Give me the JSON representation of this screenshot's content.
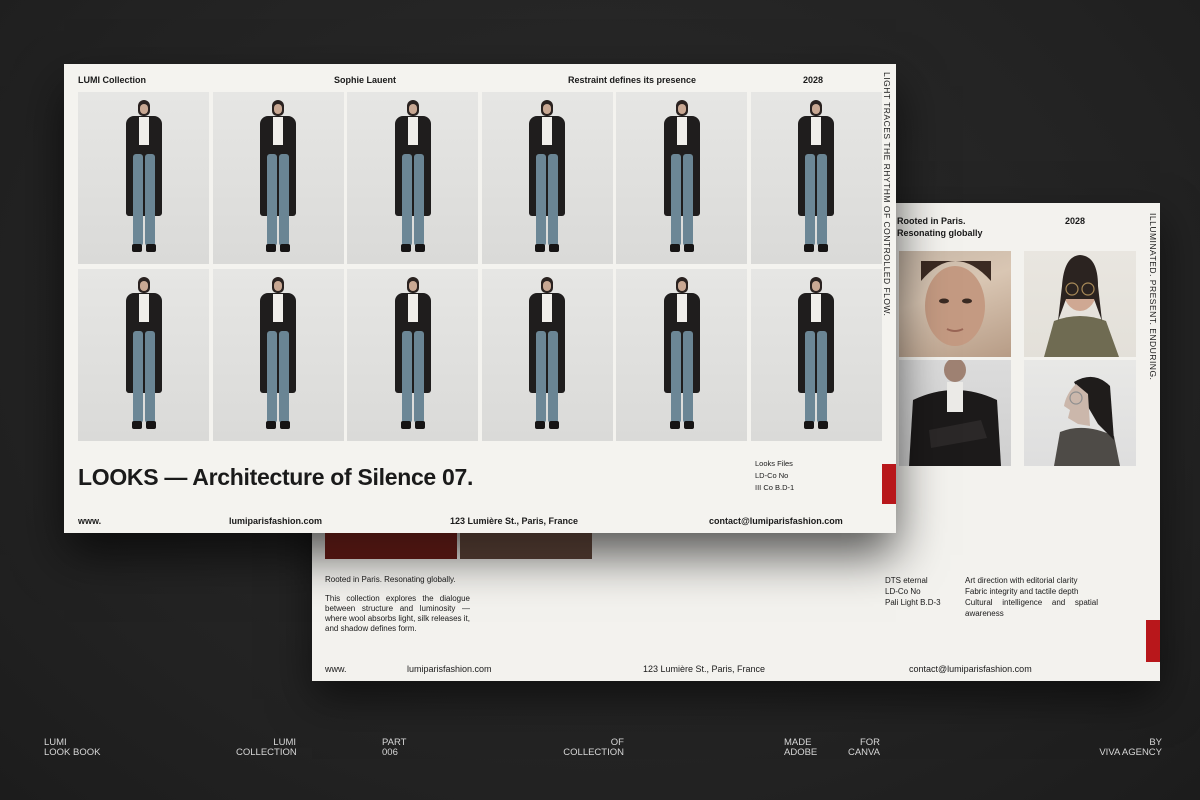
{
  "front": {
    "header": {
      "collection": "LUMI Collection",
      "designer": "Sophie Lauent",
      "tagline": "Restraint defines its presence",
      "year": "2028"
    },
    "side_text": "LIGHT TRACES THE RHYTHM OF CONTROLLED FLOW.",
    "title": "LOOKS — Architecture of Silence 07.",
    "files": [
      "Looks Files",
      "LD-Co No",
      "III Co B.D-1"
    ],
    "footer": {
      "www": "www.",
      "site": "lumiparisfashion.com",
      "address": "123 Lumière St., Paris, France",
      "email": "contact@lumiparisfashion.com"
    },
    "look_count": 12
  },
  "back": {
    "header": {
      "rooted": "Rooted in Paris. Resonating globally",
      "year": "2028"
    },
    "side_text": "ILLUMINATED. PRESENT. ENDURING.",
    "col1": {
      "lead": "Rooted in Paris. Resonating globally.",
      "body": "This collection explores the dialogue between structure and luminosity — where wool absorbs light, silk releases it, and shadow defines form."
    },
    "col2": [
      "DTS eternal",
      "LD-Co No",
      "Pali Light B.D-3"
    ],
    "col3": [
      "Art direction with editorial clarity",
      "Fabric integrity and tactile depth",
      "Cultural intelligence and spatial awareness"
    ],
    "footer": {
      "www": "www.",
      "site": "lumiparisfashion.com",
      "address": "123 Lumière St., Paris, France",
      "email": "contact@lumiparisfashion.com"
    }
  },
  "caption": {
    "c1": "LUMI\nLOOK BOOK",
    "c2": "LUMI\nCOLLECTION",
    "c3": "PART\n006",
    "c4": "OF\nCOLLECTION",
    "c5": "MADE\nADOBE",
    "c6": "FOR\nCANVA",
    "c7": "BY\nVIVA AGENCY"
  },
  "colors": {
    "accent": "#b8171b",
    "paper": "#f4f3ef",
    "background": "#252525"
  }
}
